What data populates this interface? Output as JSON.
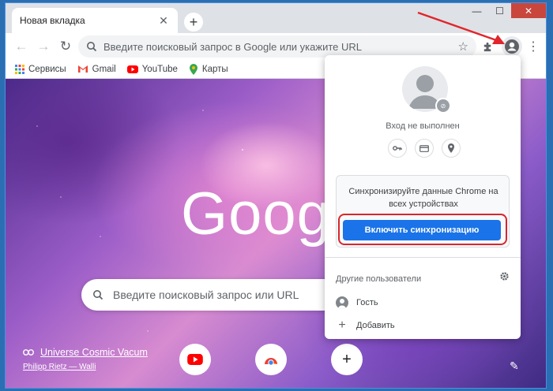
{
  "window": {
    "controls": {
      "minimize": "—",
      "maximize": "☐",
      "close": "✕"
    }
  },
  "tab": {
    "title": "Новая вкладка",
    "close": "✕"
  },
  "newtab_label": "+",
  "toolbar": {
    "back": "←",
    "forward": "→",
    "reload": "↻",
    "omnibox_placeholder": "Введите поисковый запрос в Google или укажите URL",
    "star": "☆",
    "extensions": "🧩",
    "menu": "⋮"
  },
  "bookmarks": [
    {
      "label": "Сервисы",
      "icon": "apps-grid-icon"
    },
    {
      "label": "Gmail",
      "icon": "gmail-icon"
    },
    {
      "label": "YouTube",
      "icon": "youtube-icon"
    },
    {
      "label": "Карты",
      "icon": "maps-icon"
    }
  ],
  "ntp": {
    "logo": "Google",
    "search_placeholder": "Введите поисковый запрос или URL",
    "attribution_title": "Universe Cosmic Vacum",
    "attribution_author": "Philipp Rietz — Walli",
    "edit_icon": "✎"
  },
  "popup": {
    "status": "Вход не выполнен",
    "sync_text": "Синхронизируйте данные Chrome на всех устройствах",
    "sync_button": "Включить синхронизацию",
    "others_label": "Другие пользователи",
    "guest_label": "Гость",
    "add_label": "Добавить"
  },
  "colors": {
    "accent": "#1a73e8",
    "highlight": "#d9262c",
    "arrow": "#e0262c"
  }
}
